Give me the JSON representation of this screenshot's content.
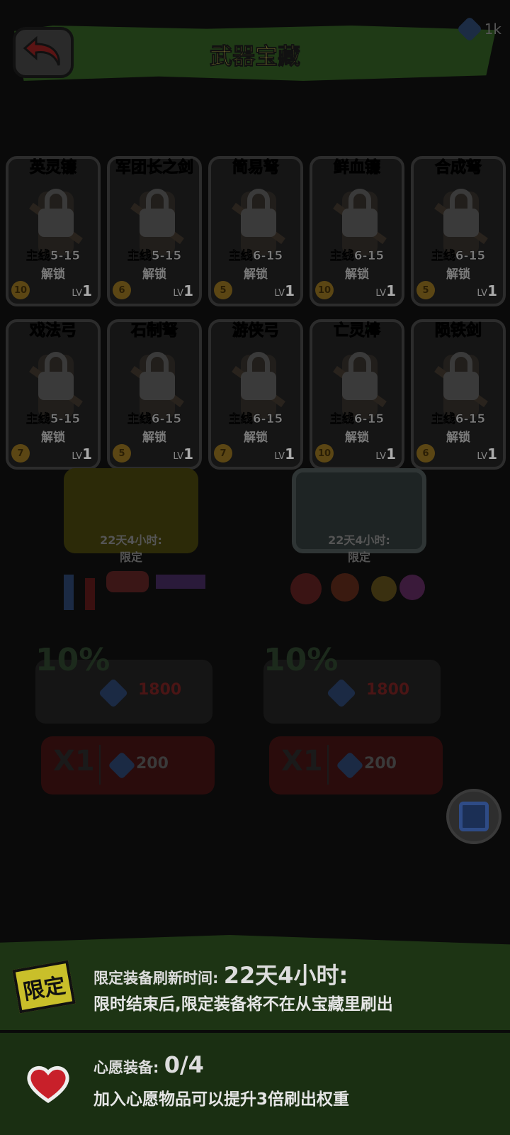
{
  "header": {
    "title": "武器宝藏",
    "gem_count": "1k"
  },
  "weapons": [
    {
      "name": "英灵镰",
      "name_color": "#2e5a3a",
      "stage": "主线5-15",
      "unlock": "解锁",
      "cost": "10",
      "lv_label": "LV",
      "lv": "1"
    },
    {
      "name": "军团长之剑",
      "name_color": "#2a4a6a",
      "stage": "主线5-15",
      "unlock": "解锁",
      "cost": "6",
      "lv_label": "LV",
      "lv": "1"
    },
    {
      "name": "简易弩",
      "name_color": "#555555",
      "stage": "主线6-15",
      "unlock": "解锁",
      "cost": "5",
      "lv_label": "LV",
      "lv": "1"
    },
    {
      "name": "鲜血镰",
      "name_color": "#2e5a3a",
      "stage": "主线6-15",
      "unlock": "解锁",
      "cost": "10",
      "lv_label": "LV",
      "lv": "1"
    },
    {
      "name": "合成弩",
      "name_color": "#2e5a3a",
      "stage": "主线6-15",
      "unlock": "解锁",
      "cost": "5",
      "lv_label": "LV",
      "lv": "1"
    },
    {
      "name": "戏法弓",
      "name_color": "#2e5a3a",
      "stage": "主线5-15",
      "unlock": "解锁",
      "cost": "7",
      "lv_label": "LV",
      "lv": "1"
    },
    {
      "name": "石制弩",
      "name_color": "#555555",
      "stage": "主线6-15",
      "unlock": "解锁",
      "cost": "5",
      "lv_label": "LV",
      "lv": "1"
    },
    {
      "name": "游侠弓",
      "name_color": "#555555",
      "stage": "主线6-15",
      "unlock": "解锁",
      "cost": "7",
      "lv_label": "LV",
      "lv": "1"
    },
    {
      "name": "亡灵棒",
      "name_color": "#2e5a3a",
      "stage": "主线6-15",
      "unlock": "解锁",
      "cost": "10",
      "lv_label": "LV",
      "lv": "1"
    },
    {
      "name": "陨铁剑",
      "name_color": "#2a4a6a",
      "stage": "主线6-15",
      "unlock": "解锁",
      "cost": "6",
      "lv_label": "LV",
      "lv": "1"
    }
  ],
  "treasures": [
    {
      "timer": "22天4小时:",
      "timer_sub": "限定",
      "discount": "10%",
      "price": "1800",
      "buy_count": "X1",
      "buy_price": "200"
    },
    {
      "timer": "22天4小时:",
      "timer_sub": "限定",
      "discount": "10%",
      "price": "1800",
      "buy_count": "X1",
      "buy_price": "200"
    }
  ],
  "limited": {
    "badge": "限定",
    "label": "限定装备刷新时间: ",
    "time": "22天4小时:",
    "description": "限时结束后,限定装备将不在从宝藏里刷出"
  },
  "wish": {
    "label": "心愿装备: ",
    "count": "0/4",
    "description": "加入心愿物品可以提升3倍刷出权重"
  },
  "colors": {
    "limited_badge": "#c9bf2a",
    "panel_green": "#1d3414",
    "title_yellow": "#c9c24a"
  }
}
